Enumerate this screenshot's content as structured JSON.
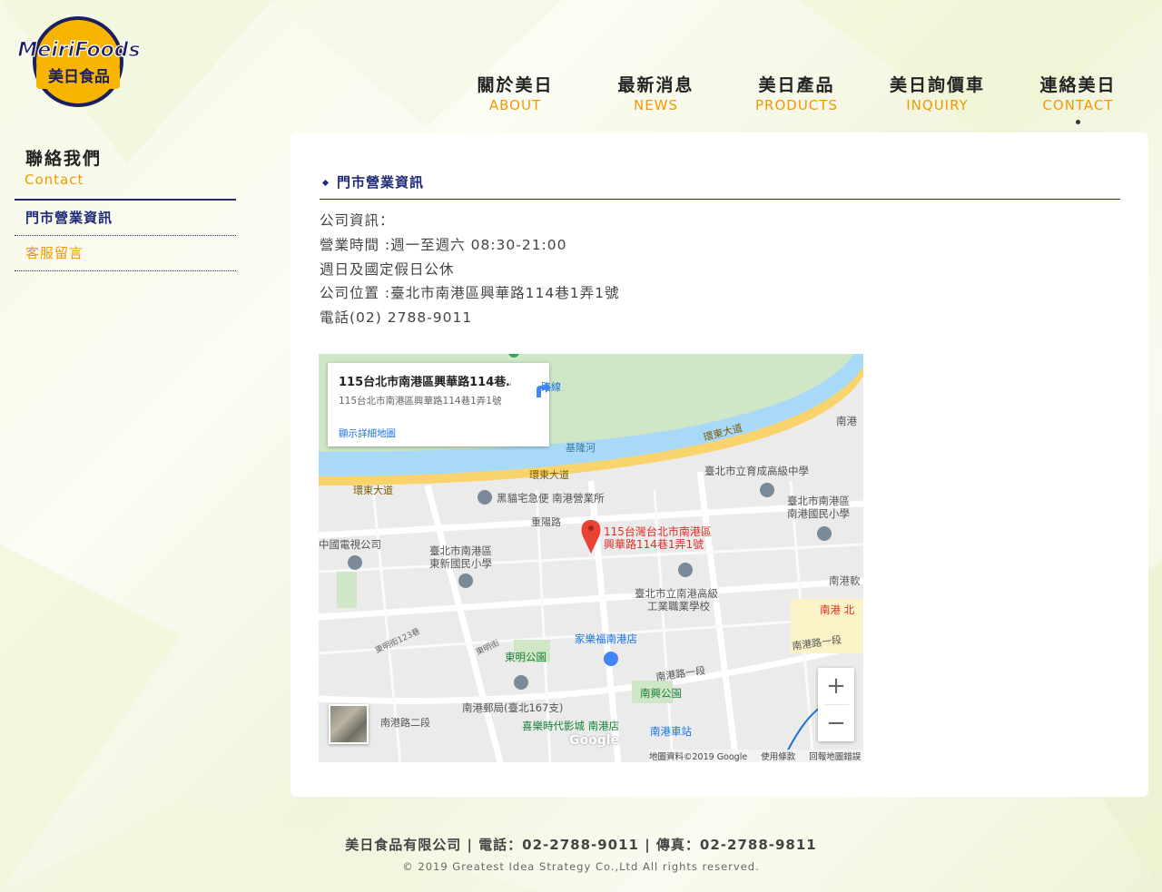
{
  "logo": {
    "brand_en": "MeiriFoods",
    "brand_zh": "美日食品"
  },
  "nav": [
    {
      "zh": "關於美日",
      "en": "ABOUT"
    },
    {
      "zh": "最新消息",
      "en": "NEWS"
    },
    {
      "zh": "美日產品",
      "en": "PRODUCTS"
    },
    {
      "zh": "美日詢價車",
      "en": "INQUIRY"
    },
    {
      "zh": "連絡美日",
      "en": "CONTACT"
    }
  ],
  "sidebar": {
    "title": "聯絡我們",
    "subtitle": "Contact",
    "items": [
      {
        "label": "門市營業資訊"
      },
      {
        "label": "客服留言"
      }
    ]
  },
  "section": {
    "title": "門市營業資訊",
    "lines": [
      "公司資訊：",
      "營業時間 :週一至週六 08:30-21:00",
      "週日及國定假日公休",
      "公司位置 :臺北市南港區興華路114巷1弄1號",
      "電話(02) 2788-9011"
    ]
  },
  "map": {
    "card_title": "115台北市南港區興華路114巷…",
    "card_address": "115台北市南港區興華路114巷1弄1號",
    "directions_label": "路線",
    "view_larger_label": "顯示詳細地圖",
    "pin_label_1": "115台灣台北市南港區",
    "pin_label_2": "興華路114巷1弄1號",
    "places": {
      "river": "基隆河",
      "road_east1": "環東大道",
      "road_east2": "環東大道",
      "road_east3": "環東大道",
      "black_cat": "黑貓宅急便 南港營業所",
      "yucheng": "臺北市立育成高級中學",
      "nangang_elem_1": "臺北市南港區",
      "nangang_elem_2": "南港國民小學",
      "chongyang": "重陽路",
      "ctv": "中國電視公司",
      "dongxin_1": "臺北市南港區",
      "dongxin_2": "東新國民小學",
      "vocational_1": "臺北市立南港高級",
      "vocational_2": "工業職業學校",
      "carrefour": "家樂福南港店",
      "dongming_park": "東明公園",
      "nangang_rd1": "南港路一段",
      "nangang_rd1b": "南港路一段",
      "nanxing_park": "南興公園",
      "post_office": "南港郵局(臺北167支)",
      "cinema": "喜樂時代影城 南港店",
      "nangang_rd2": "南港路二段",
      "station": "南港車站",
      "nangang_top": "南港",
      "nangang_right": "南港軟",
      "nangang_north": "南港 北",
      "dongming_123": "東明街123巷",
      "dongming_st": "東明街"
    },
    "google": "Google",
    "footer": [
      "地圖資料©2019 Google",
      "使用條款",
      "回報地圖錯誤"
    ]
  },
  "footer": {
    "line1": "美日食品有限公司 | 電話：02-2788-9011 | 傳真：02-2788-9811",
    "line2": "© 2019 Greatest Idea Strategy Co.,Ltd All rights reserved."
  },
  "colors": {
    "accent": "#f39800",
    "navy": "#1f2a78",
    "pin": "#ea4335",
    "river": "#a8daf7"
  }
}
